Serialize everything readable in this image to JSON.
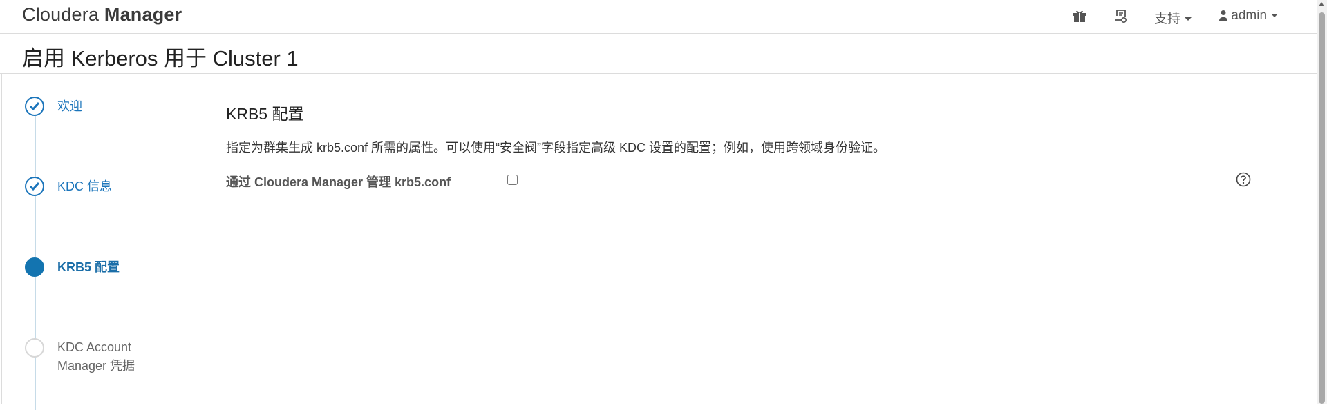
{
  "brand": {
    "light": "Cloudera",
    "bold": "Manager"
  },
  "topnav": {
    "gift_icon": "gift-icon",
    "tasks_icon": "running-commands-icon",
    "support_label": "支持",
    "user_label": "admin",
    "user_icon": "user-icon"
  },
  "page": {
    "title": "启用 Kerberos 用于 Cluster 1"
  },
  "steps": [
    {
      "label": "欢迎",
      "state": "done"
    },
    {
      "label": "KDC 信息",
      "state": "done"
    },
    {
      "label": "KRB5 配置",
      "state": "active"
    },
    {
      "label": "KDC Account Manager 凭据",
      "state": "pending"
    }
  ],
  "main": {
    "section_title": "KRB5 配置",
    "description": "指定为群集生成 krb5.conf 所需的属性。可以使用“安全阀”字段指定高级 KDC 设置的配置；例如，使用跨领域身份验证。",
    "field_label": "通过 Cloudera Manager 管理 krb5.conf",
    "field_checked": false,
    "help_icon": "help-icon"
  },
  "colors": {
    "accent": "#1b75bb",
    "border": "#dcdcdc",
    "pending": "#d7d7d7"
  }
}
